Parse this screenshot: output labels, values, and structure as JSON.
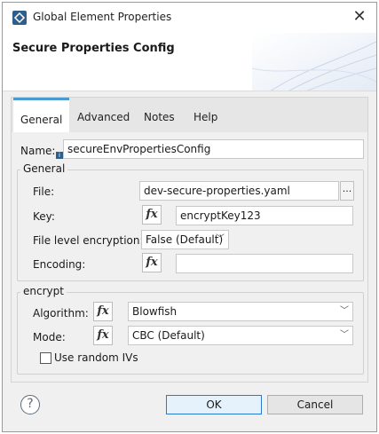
{
  "window": {
    "title": "Global Element Properties",
    "close_glyph": "✕"
  },
  "header": {
    "title": "Secure Properties Config"
  },
  "tabs": [
    {
      "label": "General",
      "active": true
    },
    {
      "label": "Advanced",
      "active": false
    },
    {
      "label": "Notes",
      "active": false
    },
    {
      "label": "Help",
      "active": false
    }
  ],
  "name_field": {
    "label": "Name:",
    "value": "secureEnvPropertiesConfig"
  },
  "general_group": {
    "title": "General",
    "file": {
      "label": "File:",
      "value": "dev-secure-properties.yaml",
      "browse_label": "..."
    },
    "key": {
      "label": "Key:",
      "value": "encryptKey123"
    },
    "file_level_encryption": {
      "label": "File level encryption:",
      "value": "False (Default)"
    },
    "encoding": {
      "label": "Encoding:",
      "value": ""
    }
  },
  "encrypt_group": {
    "title": "encrypt",
    "algorithm": {
      "label": "Algorithm:",
      "value": "Blowfish"
    },
    "mode": {
      "label": "Mode:",
      "value": "CBC (Default)"
    },
    "use_random_ivs": {
      "label": "Use random IVs",
      "checked": false
    }
  },
  "fx_label": "fx",
  "footer": {
    "help_glyph": "?",
    "ok_label": "OK",
    "cancel_label": "Cancel"
  },
  "colors": {
    "accent": "#4a9ad4",
    "app_icon": "#2d5f8a"
  }
}
